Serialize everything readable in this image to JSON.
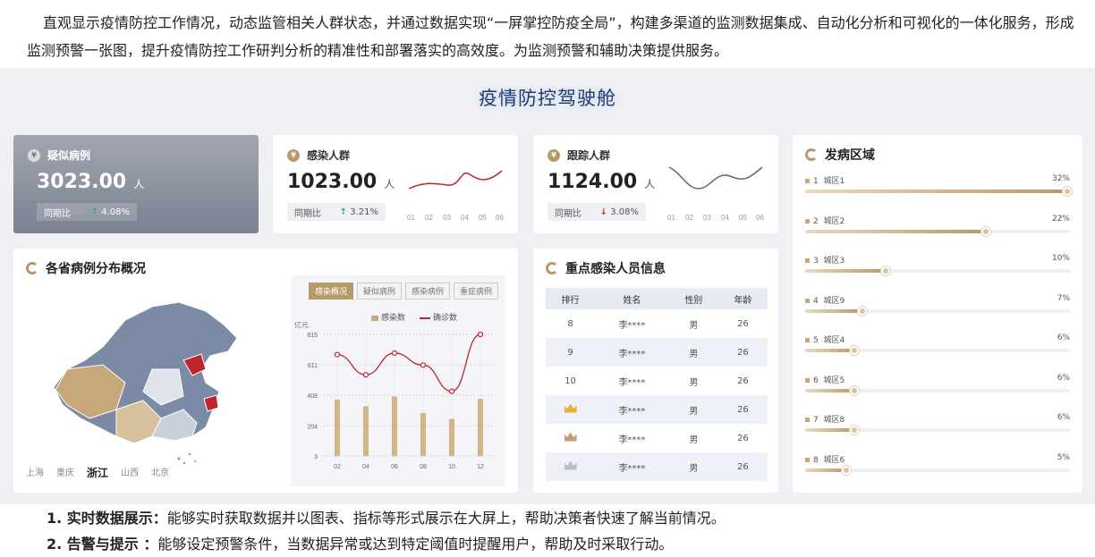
{
  "intro": "直观显示疫情防控工作情况，动态监管相关人群状态，并通过数据实现“一屏掌控防疫全局”，构建多渠道的监测数据集成、自动化分析和可视化的一体化服务，形成监测预警一张图，提升疫情防控工作研判分析的精准性和部署落实的高效度。为监测预警和辅助决策提供服务。",
  "board_title": "疫情防控驾驶舱",
  "kpis": [
    {
      "title": "疑似病例",
      "value": "3023.00",
      "unit": "人",
      "compare_label": "同期比",
      "change": "4.08%",
      "direction": "up"
    },
    {
      "title": "感染人群",
      "value": "1023.00",
      "unit": "人",
      "compare_label": "同期比",
      "change": "3.21%",
      "direction": "up"
    },
    {
      "title": "跟踪人群",
      "value": "1124.00",
      "unit": "人",
      "compare_label": "同期比",
      "change": "3.08%",
      "direction": "down"
    }
  ],
  "spark_ticks": [
    "01",
    "02",
    "03",
    "04",
    "05",
    "06"
  ],
  "province_section": {
    "title": "各省病例分布概况",
    "map_tabs": [
      "上海",
      "重庆",
      "浙江",
      "山西",
      "北京"
    ],
    "active_map_tab": "浙江"
  },
  "chart_tabs": [
    "感染概况",
    "疑似病例",
    "感染病例",
    "重症病例"
  ],
  "active_chart_tab": "感染概况",
  "chart_data": {
    "type": "bar",
    "title": "",
    "ylabel": "亿元",
    "categories": [
      "02",
      "04",
      "06",
      "08",
      "10",
      "12"
    ],
    "y_ticks": [
      "3",
      "204",
      "408",
      "611",
      "815"
    ],
    "ylim": [
      3,
      815
    ],
    "series": [
      {
        "name": "感染数",
        "type": "bar",
        "values": [
          380,
          335,
          400,
          290,
          250,
          385
        ]
      },
      {
        "name": "确诊数",
        "type": "line",
        "values": [
          680,
          545,
          690,
          610,
          435,
          815
        ]
      }
    ]
  },
  "key_persons": {
    "title": "重点感染人员信息",
    "headers": [
      "排行",
      "姓名",
      "性别",
      "年龄"
    ],
    "rows": [
      {
        "rank": "8",
        "name": "李****",
        "gender": "男",
        "age": "26"
      },
      {
        "rank": "9",
        "name": "李****",
        "gender": "男",
        "age": "26"
      },
      {
        "rank": "10",
        "name": "李****",
        "gender": "男",
        "age": "26"
      },
      {
        "rank": "",
        "crown": "gold",
        "name": "李****",
        "gender": "男",
        "age": "26"
      },
      {
        "rank": "",
        "crown": "bronze",
        "name": "李****",
        "gender": "男",
        "age": "26"
      },
      {
        "rank": "",
        "crown": "silver",
        "name": "李****",
        "gender": "男",
        "age": "26"
      }
    ]
  },
  "districts": {
    "title": "发病区域",
    "items": [
      {
        "no": "1",
        "name": "城区1",
        "pct": "32%",
        "level": 1.0
      },
      {
        "no": "2",
        "name": "城区2",
        "pct": "22%",
        "level": 0.69
      },
      {
        "no": "3",
        "name": "城区3",
        "pct": "10%",
        "level": 0.31
      },
      {
        "no": "4",
        "name": "城区9",
        "pct": "7%",
        "level": 0.22
      },
      {
        "no": "5",
        "name": "城区4",
        "pct": "6%",
        "level": 0.19
      },
      {
        "no": "6",
        "name": "城区5",
        "pct": "6%",
        "level": 0.19
      },
      {
        "no": "7",
        "name": "城区8",
        "pct": "6%",
        "level": 0.19
      },
      {
        "no": "8",
        "name": "城区6",
        "pct": "5%",
        "level": 0.16
      }
    ]
  },
  "bullets": [
    {
      "label": "1. 实时数据展示：",
      "text": "能够实时获取数据并以图表、指标等形式展示在大屏上，帮助决策者快速了解当前情况。"
    },
    {
      "label": "2. 告警与提示 ：",
      "text": "能够设定预警条件，当数据异常或达到特定阈值时提醒用户，帮助及时采取行动。"
    }
  ],
  "colors": {
    "gold": "#b79a6a",
    "red": "#c0252d",
    "navy": "#1f3b6e"
  }
}
